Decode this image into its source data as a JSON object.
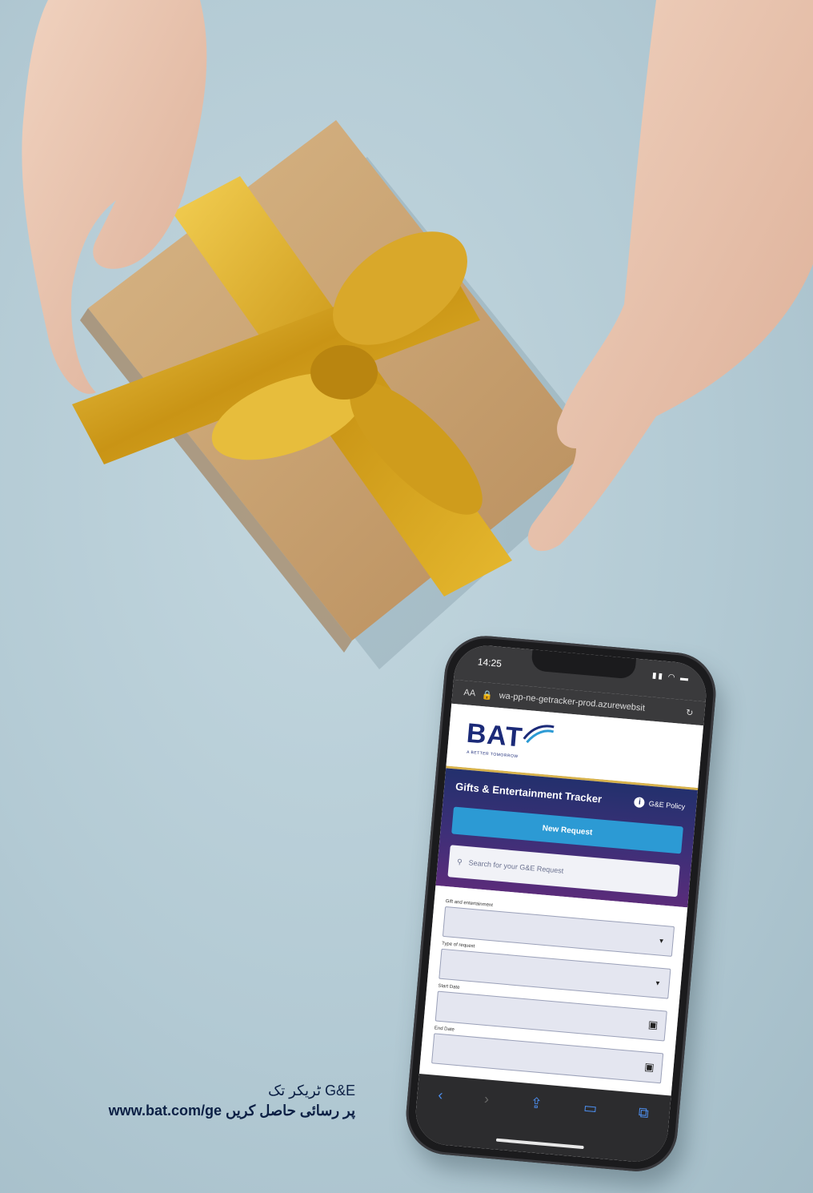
{
  "phone": {
    "status_time": "14:25",
    "url_prefix": "AA",
    "url": "wa-pp-ne-getracker-prod.azurewebsit",
    "logo": "BAT",
    "logo_tagline": "A BETTER TOMORROW",
    "app_title": "Gifts & Entertainment Tracker",
    "policy_link": "G&E Policy",
    "new_request_label": "New Request",
    "search_placeholder": "Search for your G&E Request",
    "fields": [
      {
        "label": "Gift and entertainment",
        "kind": "select"
      },
      {
        "label": "Type of request",
        "kind": "select"
      },
      {
        "label": "Start Date",
        "kind": "date"
      },
      {
        "label": "End Date",
        "kind": "date"
      }
    ],
    "icons": [
      "lock-icon",
      "reload-icon",
      "back-icon",
      "forward-icon",
      "share-icon",
      "bookmarks-icon",
      "tabs-icon",
      "info-icon",
      "search-icon",
      "chevron-down-icon",
      "calendar-icon"
    ]
  },
  "caption": {
    "line1": "G&E ٹریکر تک",
    "line2": "پر رسائی حاصل کریں  www.bat.com/ge"
  }
}
